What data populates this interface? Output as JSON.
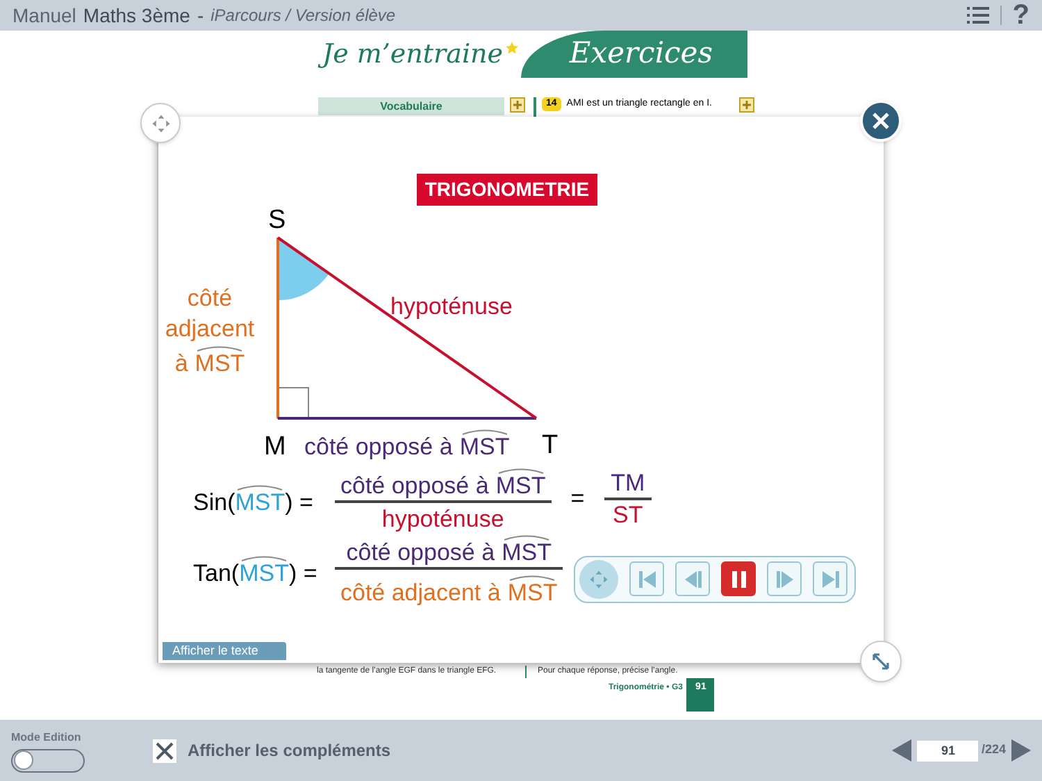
{
  "header": {
    "title_light": "Manuel",
    "title_bold": "Maths 3ème",
    "separator": "-",
    "subtitle": "iParcours / Version élève",
    "help_glyph": "?"
  },
  "page": {
    "banner_left": "Je m’entraine",
    "banner_right": "Exercices",
    "vocab_label": "Vocabulaire",
    "exercise_number": "14",
    "exercise_text": "AMI est un triangle rectangle en I.",
    "bottom_left_text": "la tangente de l’angle EGF dans le triangle EFG.",
    "bottom_right_text": "Pour chaque réponse, précise l’angle.",
    "footer_label": "Trigonométrie • G3",
    "page_number": "91"
  },
  "popup": {
    "title": "TRIGONOMETRIE",
    "diagram": {
      "vertex_top": "S",
      "vertex_right_angle": "M",
      "vertex_right": "T",
      "adjacent_lines": [
        "côté",
        "adjacent"
      ],
      "adjacent_prefix": "à",
      "adjacent_angle": "MST",
      "hypotenuse": "hypoténuse",
      "opposite_text": "côté opposé à",
      "opposite_angle": "MST"
    },
    "formulas": [
      {
        "func": "Sin(",
        "angle": "MST",
        "close": ") =",
        "numerator": {
          "text": "côté opposé à",
          "angle": "MST"
        },
        "denominator": {
          "kind": "hypotenuse",
          "text": "hypoténuse"
        },
        "result": {
          "eq": "=",
          "numerator": "TM",
          "denominator": "ST"
        }
      },
      {
        "func": "Tan(",
        "angle": "MST",
        "close": ") =",
        "numerator": {
          "text": "côté opposé à",
          "angle": "MST"
        },
        "denominator": {
          "kind": "adjacent",
          "text": "côté adjacent à",
          "angle": "MST"
        }
      }
    ],
    "show_text_button": "Afficher le texte",
    "player": {
      "playing": true
    }
  },
  "bottom_bar": {
    "mode_label": "Mode Edition",
    "mode_on": false,
    "complements_label": "Afficher les compléments",
    "complements_checked": true,
    "page_value": "91",
    "page_total": "/224"
  }
}
